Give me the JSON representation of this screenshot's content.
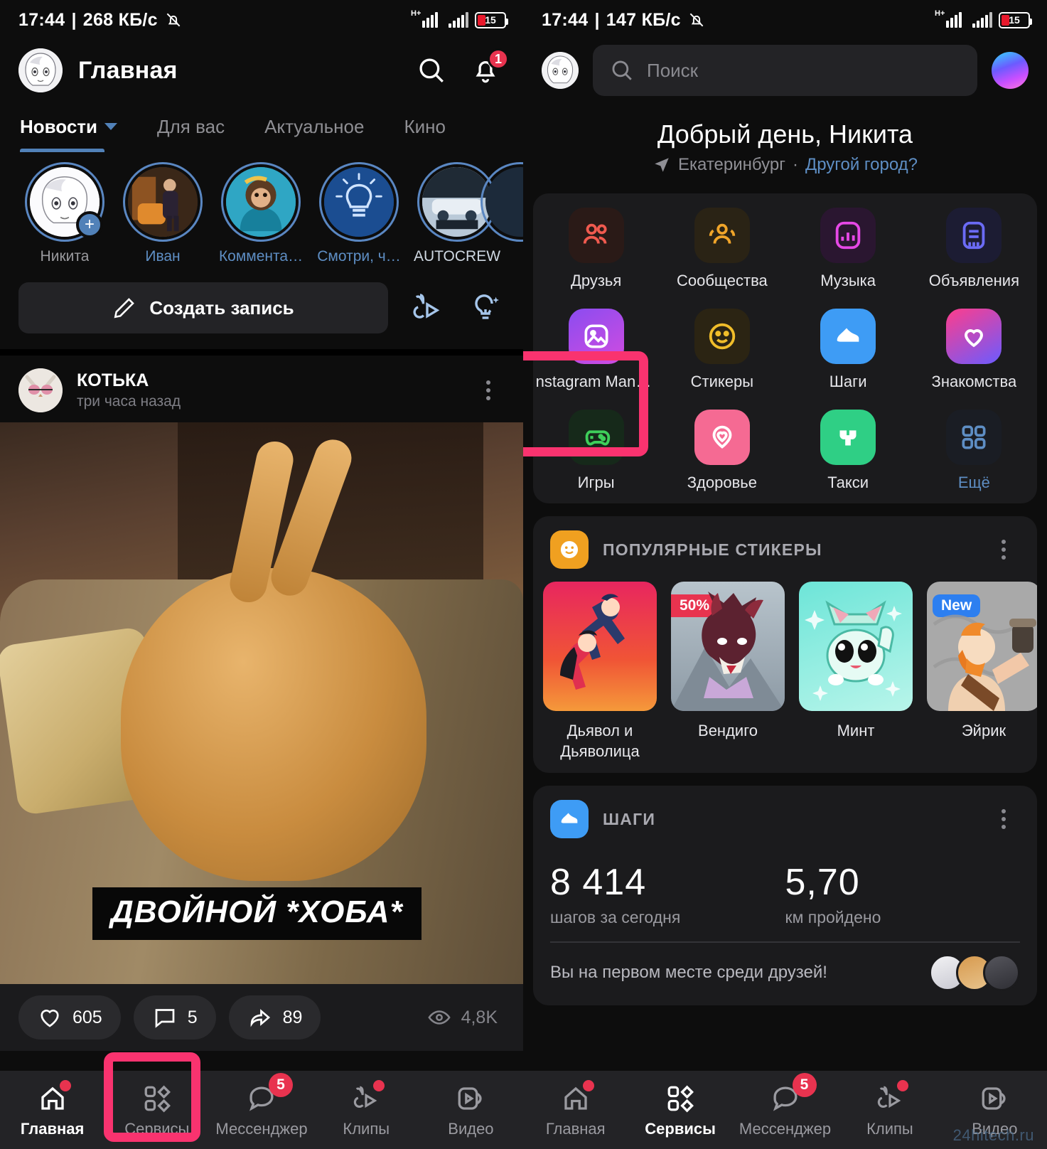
{
  "left": {
    "status": {
      "time": "17:44",
      "sep": "|",
      "speed": "268 КБ/c",
      "battery": "15"
    },
    "header": {
      "title": "Главная",
      "search_icon": "search-icon",
      "bell_icon": "bell-icon",
      "bell_badge": "1"
    },
    "tabs": [
      {
        "label": "Новости",
        "active": true,
        "has_chevron": true
      },
      {
        "label": "Для вас",
        "active": false,
        "has_chevron": false
      },
      {
        "label": "Актуальное",
        "active": false,
        "has_chevron": false
      },
      {
        "label": "Кино",
        "active": false,
        "has_chevron": false
      }
    ],
    "stories": [
      {
        "label": "Никита",
        "self": true,
        "plus": "+"
      },
      {
        "label": "Иван",
        "self": false
      },
      {
        "label": "Коммента…",
        "self": false
      },
      {
        "label": "Смотри, ч…",
        "self": false
      },
      {
        "label": "AUTOCREW",
        "self": false
      }
    ],
    "create": {
      "label": "Создать запись",
      "pencil_icon": "pencil-icon",
      "clip_icon": "clips-icon",
      "idea_icon": "lightbulb-sparkle-icon"
    },
    "post": {
      "author": "КОТЬКА",
      "time": "три часа назад",
      "menu_icon": "more-vertical-icon",
      "image_caption": "ДВОЙНОЙ *ХОБА*",
      "likes": "605",
      "comments": "5",
      "shares": "89",
      "views": "4,8K"
    },
    "bottomnav": [
      {
        "label": "Главная",
        "icon": "home-icon",
        "active": true,
        "dot": true
      },
      {
        "label": "Сервисы",
        "icon": "services-icon",
        "active": false,
        "highlighted": true
      },
      {
        "label": "Мессенджер",
        "icon": "messenger-icon",
        "active": false,
        "badge": "5"
      },
      {
        "label": "Клипы",
        "icon": "clips-icon",
        "active": false,
        "dot": true
      },
      {
        "label": "Видео",
        "icon": "video-icon",
        "active": false
      }
    ]
  },
  "right": {
    "status": {
      "time": "17:44",
      "sep": "|",
      "speed": "147 КБ/c",
      "battery": "15"
    },
    "header": {
      "search_placeholder": "Поиск",
      "search_icon": "search-icon",
      "assistant_icon": "assistant-orb-icon"
    },
    "greeting": {
      "title": "Добрый день, Никита",
      "city": "Екатеринбург",
      "separator": "·",
      "change_city": "Другой город?",
      "pin_icon": "location-pin-icon"
    },
    "services": [
      {
        "label": "Друзья",
        "icon": "friends-icon",
        "color": "#f05a4f",
        "bg": "#2a1a17"
      },
      {
        "label": "Сообщества",
        "icon": "groups-icon",
        "color": "#f0a52a",
        "bg": "#2a2315"
      },
      {
        "label": "Музыка",
        "icon": "music-icon",
        "color": "#e648e6",
        "bg": "#2a1630"
      },
      {
        "label": "Объявления",
        "icon": "ads-icon",
        "color": "#6b6bf5",
        "bg": "#1c1c33"
      },
      {
        "label": "nstagram Manag…",
        "icon": "photo-icon",
        "color": "#ffffff",
        "bg": "linear-gradient(150deg,#8b4cf0,#d14ce0)",
        "highlighted": true
      },
      {
        "label": "Стикеры",
        "icon": "smiley-icon",
        "color": "#f0bd2a",
        "bg": "#2b2413"
      },
      {
        "label": "Шаги",
        "icon": "shoe-icon",
        "color": "#ffffff",
        "bg": "#3e9cf5"
      },
      {
        "label": "Знакомства",
        "icon": "heart-icon",
        "color": "#ffffff",
        "bg": "linear-gradient(150deg,#ff3d8b,#8b4cf0)"
      },
      {
        "label": "Игры",
        "icon": "gamepad-icon",
        "color": "#3ecf5a",
        "bg": "#16291a"
      },
      {
        "label": "Здоровье",
        "icon": "health-icon",
        "color": "#ffffff",
        "bg": "#f56a93"
      },
      {
        "label": "Такси",
        "icon": "taxi-icon",
        "color": "#ffffff",
        "bg": "#2fcf85"
      },
      {
        "label": "Ещё",
        "icon": "grid-more-icon",
        "color": "#5e8ec4",
        "bg": "#1a1d24",
        "is_link": true
      }
    ],
    "stickers_section": {
      "title": "ПОПУЛЯРНЫЕ СТИКЕРЫ",
      "icon": "smiley-icon",
      "menu_icon": "more-vertical-icon",
      "items": [
        {
          "name": "Дьявол и Дьяволица",
          "badge": "",
          "badge_kind": ""
        },
        {
          "name": "Вендиго",
          "badge": "50%",
          "badge_kind": "sale"
        },
        {
          "name": "Минт",
          "badge": "",
          "badge_kind": ""
        },
        {
          "name": "Эйрик",
          "badge": "New",
          "badge_kind": "new"
        }
      ]
    },
    "steps_section": {
      "title": "ШАГИ",
      "icon": "shoe-icon",
      "menu_icon": "more-vertical-icon",
      "steps_value": "8 414",
      "steps_label": "шагов за сегодня",
      "distance_value": "5,70",
      "distance_label": "км пройдено",
      "rank_text": "Вы на первом месте среди друзей!"
    },
    "bottomnav": [
      {
        "label": "Главная",
        "icon": "home-icon",
        "active": false,
        "dot": true
      },
      {
        "label": "Сервисы",
        "icon": "services-icon",
        "active": true
      },
      {
        "label": "Мессенджер",
        "icon": "messenger-icon",
        "active": false,
        "badge": "5"
      },
      {
        "label": "Клипы",
        "icon": "clips-icon",
        "active": false,
        "dot": true
      },
      {
        "label": "Видео",
        "icon": "video-icon",
        "active": false
      }
    ]
  },
  "watermark": "24hitech.ru",
  "accent": {
    "highlight": "#f9336f",
    "link": "#5e8ec4",
    "badge_red": "#e8334f"
  }
}
